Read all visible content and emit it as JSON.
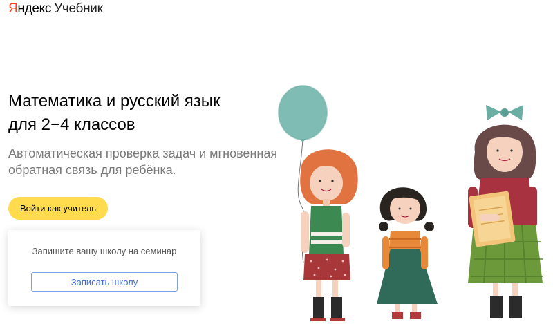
{
  "header": {
    "logo_brand_first": "Я",
    "logo_brand_rest": "ндекс",
    "logo_product": "Учебник"
  },
  "hero": {
    "title_line1": "Математика и русский язык",
    "title_line2": "для 2−4 классов",
    "subtitle_line1": "Автоматическая проверка задач и мгновенная",
    "subtitle_line2": "обратная связь для ребёнка.",
    "teacher_button_label": "Войти как учитель"
  },
  "seminar": {
    "prompt": "Запишите вашу школу на семинар",
    "button_label": "Записать школу"
  },
  "colors": {
    "brand_red": "#fc3f1d",
    "primary_yellow": "#ffdb4d",
    "link_blue": "#3d6fd6"
  }
}
